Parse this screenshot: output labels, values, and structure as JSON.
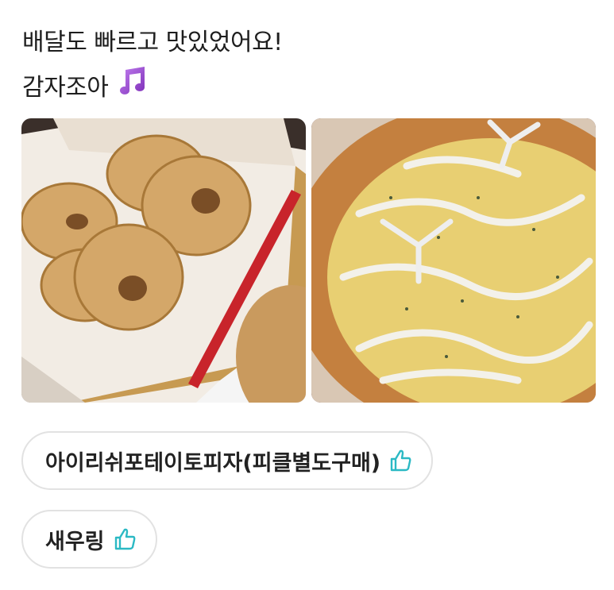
{
  "review": {
    "line1": "배달도 빠르고 맛있었어요!",
    "line2": "감자조아",
    "line2_icon": "music-note-icon",
    "icon_color": "#a54ad6"
  },
  "photos": [
    {
      "name": "onion-rings-photo",
      "subject": "shrimp rings in box"
    },
    {
      "name": "potato-pizza-photo",
      "subject": "potato corn pizza"
    }
  ],
  "menu_chips": [
    {
      "label": "아이리쉬포테이토피자(피클별도구매)",
      "icon": "thumbs-up-icon"
    },
    {
      "label": "새우링",
      "icon": "thumbs-up-icon"
    }
  ],
  "colors": {
    "accent": "#2bb9c4",
    "chip_border": "#e2e2e2",
    "text": "#1e1e1e"
  }
}
